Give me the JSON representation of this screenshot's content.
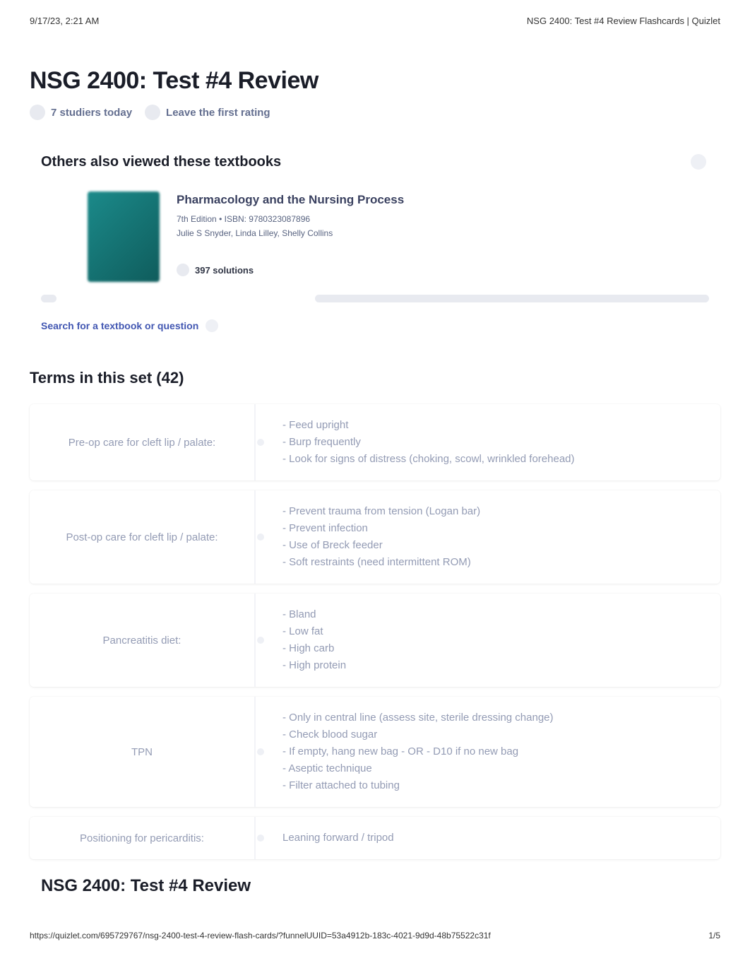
{
  "header": {
    "timestamp": "9/17/23, 2:21 AM",
    "doc_title": "NSG 2400: Test #4 Review Flashcards | Quizlet"
  },
  "page_title": "NSG 2400: Test #4 Review",
  "meta": {
    "studiers": "7 studiers today",
    "rating": "Leave the first rating"
  },
  "textbooks": {
    "heading": "Others also viewed these textbooks",
    "item": {
      "title": "Pharmacology and the Nursing Process",
      "edition": "7th Edition",
      "isbn": "ISBN: 9780323087896",
      "authors": "Julie S Snyder, Linda Lilley, Shelly Collins",
      "solutions": "397 solutions"
    },
    "search_link": "Search for a textbook or question"
  },
  "terms_heading": "Terms in this set (42)",
  "terms": [
    {
      "term": "Pre-op care for cleft lip / palate:",
      "definition": "- Feed upright\n- Burp frequently\n- Look for signs of distress (choking, scowl, wrinkled forehead)"
    },
    {
      "term": "Post-op care for cleft lip / palate:",
      "definition": "- Prevent trauma from tension (Logan bar)\n- Prevent infection\n- Use of Breck feeder\n- Soft restraints (need intermittent ROM)"
    },
    {
      "term": "Pancreatitis diet:",
      "definition": "- Bland\n- Low fat\n- High carb\n- High protein"
    },
    {
      "term": "TPN",
      "definition": "- Only in central line (assess site, sterile dressing change)\n- Check blood sugar\n- If empty, hang new bag - OR - D10 if no new bag\n- Aseptic technique\n- Filter attached to tubing"
    },
    {
      "term": "Positioning for pericarditis:",
      "definition": "Leaning forward / tripod"
    }
  ],
  "footer_title": "NSG 2400: Test #4 Review",
  "footer": {
    "url": "https://quizlet.com/695729767/nsg-2400-test-4-review-flash-cards/?funnelUUID=53a4912b-183c-4021-9d9d-48b75522c31f",
    "page": "1/5"
  }
}
